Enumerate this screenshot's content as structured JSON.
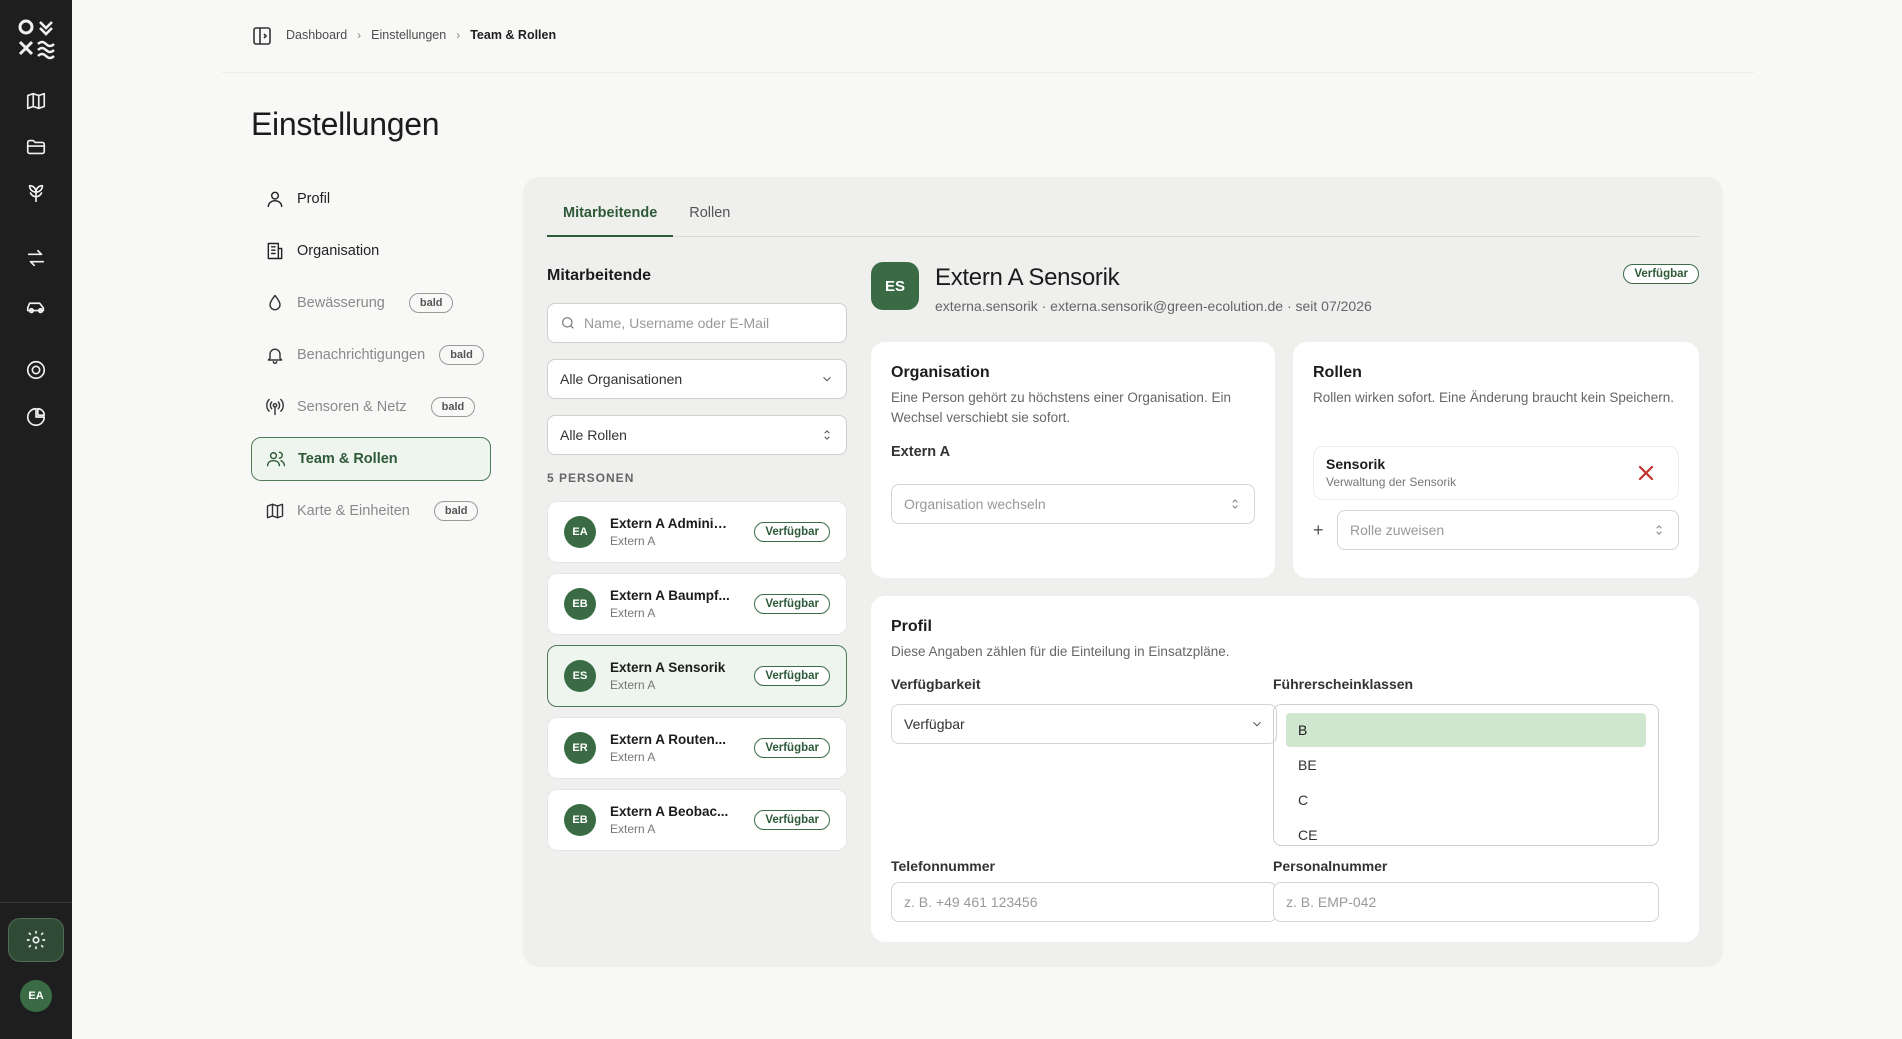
{
  "rail": {
    "items": [
      "map-icon",
      "folder-icon",
      "plant-icon",
      "swap-icon",
      "vehicle-icon",
      "target-icon",
      "pie-chart-icon"
    ],
    "settings_icon": "gear-icon",
    "avatar": "EA"
  },
  "breadcrumb": {
    "items": [
      "Dashboard",
      "Einstellungen"
    ],
    "current": "Team & Rollen"
  },
  "page": {
    "title": "Einstellungen"
  },
  "settings_nav": {
    "items": [
      {
        "label": "Profil",
        "icon": "user-icon",
        "badge": ""
      },
      {
        "label": "Organisation",
        "icon": "building-icon",
        "badge": ""
      },
      {
        "label": "Bewässerung",
        "icon": "droplet-icon",
        "badge": "bald"
      },
      {
        "label": "Benachrichtigungen",
        "icon": "bell-icon",
        "badge": "bald"
      },
      {
        "label": "Sensoren & Netz",
        "icon": "antenna-icon",
        "badge": "bald"
      },
      {
        "label": "Team & Rollen",
        "icon": "users-icon",
        "badge": ""
      },
      {
        "label": "Karte & Einheiten",
        "icon": "map-icon",
        "badge": "bald"
      }
    ]
  },
  "tabs": [
    {
      "label": "Mitarbeitende"
    },
    {
      "label": "Rollen"
    }
  ],
  "employees": {
    "heading": "Mitarbeitende",
    "search_placeholder": "Name, Username oder E-Mail",
    "org_filter": "Alle Organisationen",
    "role_filter": "Alle Rollen",
    "count_label": "5 PERSONEN",
    "list": [
      {
        "initials": "EA",
        "name": "Extern A Adminis...",
        "org": "Extern A",
        "status": "Verfügbar"
      },
      {
        "initials": "EB",
        "name": "Extern A Baumpf...",
        "org": "Extern A",
        "status": "Verfügbar"
      },
      {
        "initials": "ES",
        "name": "Extern A Sensorik",
        "org": "Extern A",
        "status": "Verfügbar"
      },
      {
        "initials": "ER",
        "name": "Extern A Routen...",
        "org": "Extern A",
        "status": "Verfügbar"
      },
      {
        "initials": "EB",
        "name": "Extern A Beobac...",
        "org": "Extern A",
        "status": "Verfügbar"
      }
    ]
  },
  "detail": {
    "initials": "ES",
    "name": "Extern A Sensorik",
    "meta": "externa.sensorik · externa.sensorik@green-ecolution.de · seit 07/2026",
    "status": "Verfügbar",
    "organisation": {
      "title": "Organisation",
      "desc": "Eine Person gehört zu höchstens einer Organisation. Ein Wechsel verschiebt sie sofort.",
      "current": "Extern A",
      "select_placeholder": "Organisation wechseln"
    },
    "roles": {
      "title": "Rollen",
      "desc": "Rollen wirken sofort. Eine Änderung braucht kein Speichern.",
      "assigned": [
        {
          "title": "Sensorik",
          "subtitle": "Verwaltung der Sensorik"
        }
      ],
      "add_placeholder": "Rolle zuweisen"
    },
    "profile": {
      "title": "Profil",
      "desc": "Diese Angaben zählen für die Einteilung in Einsatzpläne.",
      "availability_label": "Verfügbarkeit",
      "availability_value": "Verfügbar",
      "license_label": "Führerscheinklassen",
      "license_options": [
        "B",
        "BE",
        "C",
        "CE"
      ],
      "license_selected": "B",
      "phone_label": "Telefonnummer",
      "phone_placeholder": "z. B. +49 461 123456",
      "staff_label": "Personalnummer",
      "staff_placeholder": "z. B. EMP-042"
    }
  },
  "colors": {
    "accent": "#2f5a38",
    "avatar": "#3a6b45",
    "rail": "#1e1e1e",
    "danger": "#c4312b",
    "selected_option": "#cfe6cf"
  }
}
